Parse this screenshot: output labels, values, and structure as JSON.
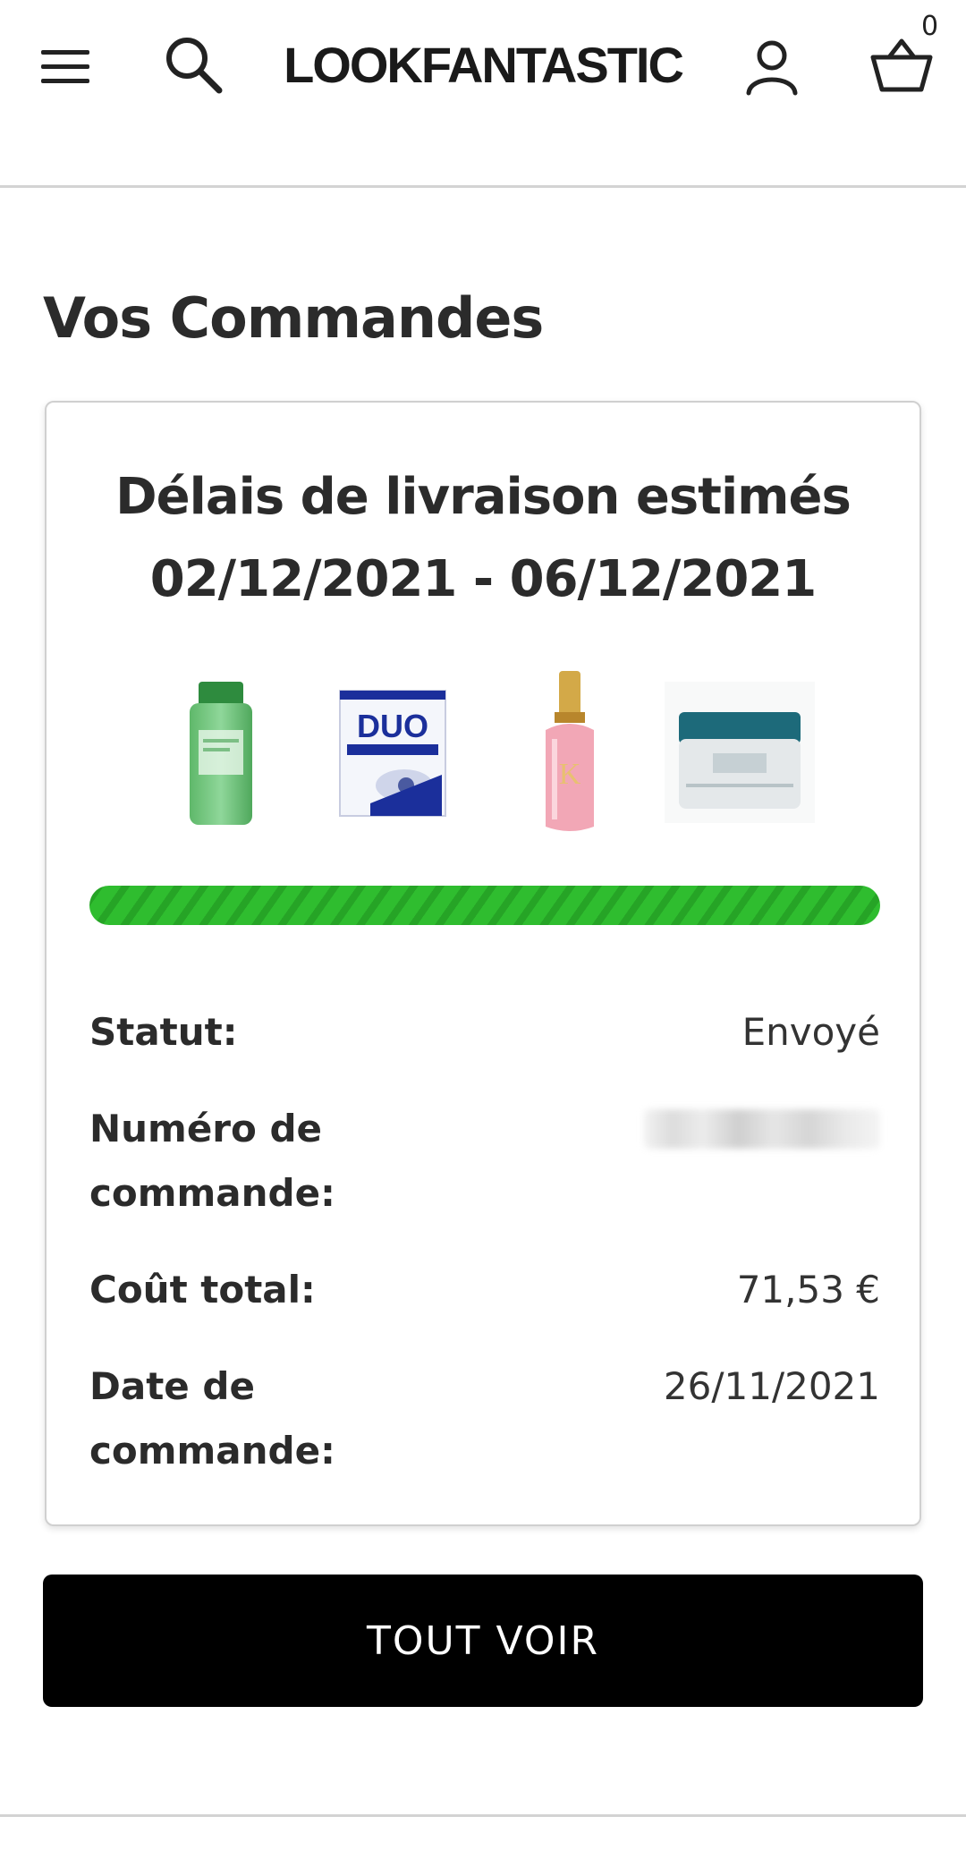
{
  "header": {
    "logo_text": "LOOKFANTASTIC",
    "basket_count": "0"
  },
  "page": {
    "title": "Vos Commandes"
  },
  "order": {
    "delivery_heading": "Délais de livraison estimés",
    "delivery_range": "02/12/2021 - 06/12/2021",
    "products": [
      {
        "icon": "green-shampoo-bottle"
      },
      {
        "icon": "duo-lash-adhesive-box"
      },
      {
        "icon": "pink-oil-bottle"
      },
      {
        "icon": "teal-lid-cream-jar"
      }
    ],
    "progress_fraction": 1.0,
    "progress_color": "#2fbd2f",
    "status_label": "Statut:",
    "status_value": "Envoyé",
    "order_number_label": "Numéro de commande:",
    "total_label": "Coût total:",
    "total_value": "71,53 €",
    "date_label": "Date de commande:",
    "date_value": "26/11/2021"
  },
  "actions": {
    "view_all_label": "TOUT VOIR"
  }
}
